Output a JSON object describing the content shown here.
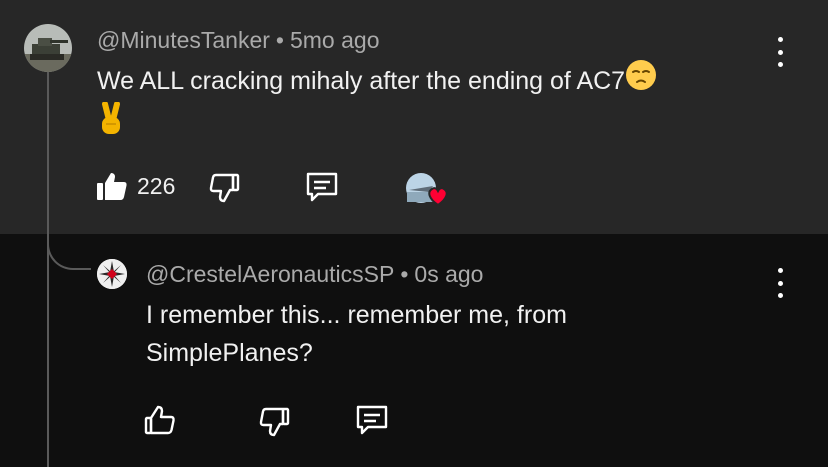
{
  "comment": {
    "handle": "@MinutesTanker",
    "separator": "•",
    "time": "5mo ago",
    "text": "We ALL cracking mihaly after the ending of AC7",
    "text_emoji_1": "pensive-face-emoji",
    "text_emoji_2": "victory-hand-emoji",
    "like_count": "226",
    "creator_heart": "creator-heart-avatar"
  },
  "reply": {
    "handle": "@CrestelAeronauticsSP",
    "separator": "•",
    "time": "0s ago",
    "text_line1": "I remember this... remember me, from",
    "text_line2": "SimplePlanes?"
  },
  "colors": {
    "top_bg": "#272727",
    "bottom_bg": "#0f0f0f",
    "meta_text": "#aaaaaa",
    "heart": "#ff0033"
  }
}
